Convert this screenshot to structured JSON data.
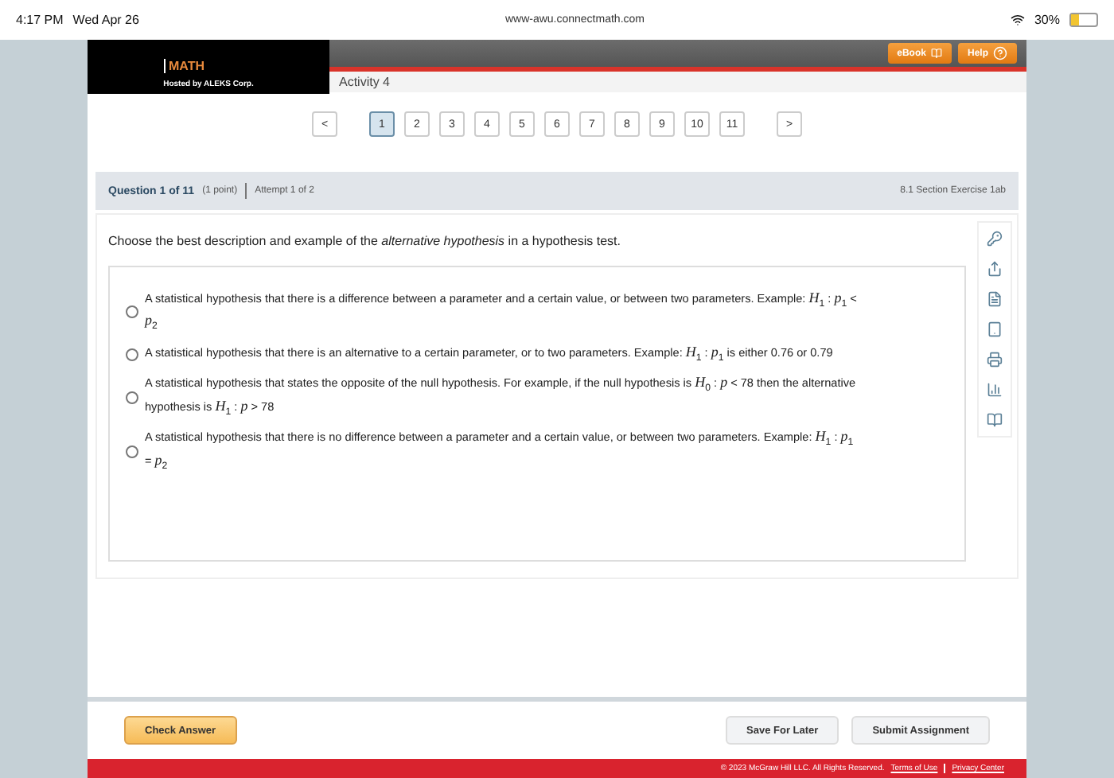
{
  "status_bar": {
    "time": "4:17 PM",
    "date": "Wed Apr 26",
    "url": "www-awu.connectmath.com",
    "battery": "30%"
  },
  "header": {
    "product": "MATH",
    "hosted_by": "Hosted by ALEKS Corp.",
    "activity": "Activity 4",
    "buttons": [
      "eBook",
      "Help"
    ]
  },
  "pagination": {
    "prev": "<",
    "next": ">",
    "pages": [
      {
        "label": "1",
        "selected": true
      },
      {
        "label": "2",
        "selected": false
      },
      {
        "label": "3",
        "selected": false
      },
      {
        "label": "4",
        "selected": false
      },
      {
        "label": "5",
        "selected": false
      },
      {
        "label": "6",
        "selected": false
      },
      {
        "label": "7",
        "selected": false
      },
      {
        "label": "8",
        "selected": false
      },
      {
        "label": "9",
        "selected": false
      },
      {
        "label": "10",
        "selected": false
      },
      {
        "label": "11",
        "selected": false
      }
    ]
  },
  "question": {
    "number": "Question 1 of 11",
    "points": "(1 point)",
    "attempt": "Attempt 1 of 2",
    "section": "8.1 Section Exercise 1ab",
    "prompt": "Choose the best description and example of the *alternative hypothesis* in a hypothesis test.",
    "options": [
      {
        "text": "A statistical hypothesis that there is a difference between a parameter and a certain value, or between two parameters. Example: *H*$_{1}$ : *p*$_{1}$ < *p*$_{2}$",
        "selected": false
      },
      {
        "text": "A statistical hypothesis that there is an alternative to a certain parameter, or to two parameters. Example: *H*$_{1}$ : *p*$_{1}$ is either 0.76 or 0.79",
        "selected": false
      },
      {
        "text": "A statistical hypothesis that states the opposite of the null hypothesis. For example, if the null hypothesis is *H*$_{0}$ : *p* < 78 then the alternative hypothesis is *H*$_{1}$ : *p* > 78",
        "selected": false
      },
      {
        "text": "A statistical hypothesis that there is no difference between a parameter and a certain value, or between two parameters. Example: *H*$_{1}$ : *p*$_{1}$ = *p*$_{2}$",
        "selected": false
      }
    ]
  },
  "footer": {
    "check": "Check Answer",
    "save": "Save For Later",
    "submit": "Submit Assignment",
    "copyright": "© 2023 McGraw Hill LLC. All Rights Reserved.",
    "links": [
      "Terms of Use",
      "Privacy Center"
    ]
  }
}
